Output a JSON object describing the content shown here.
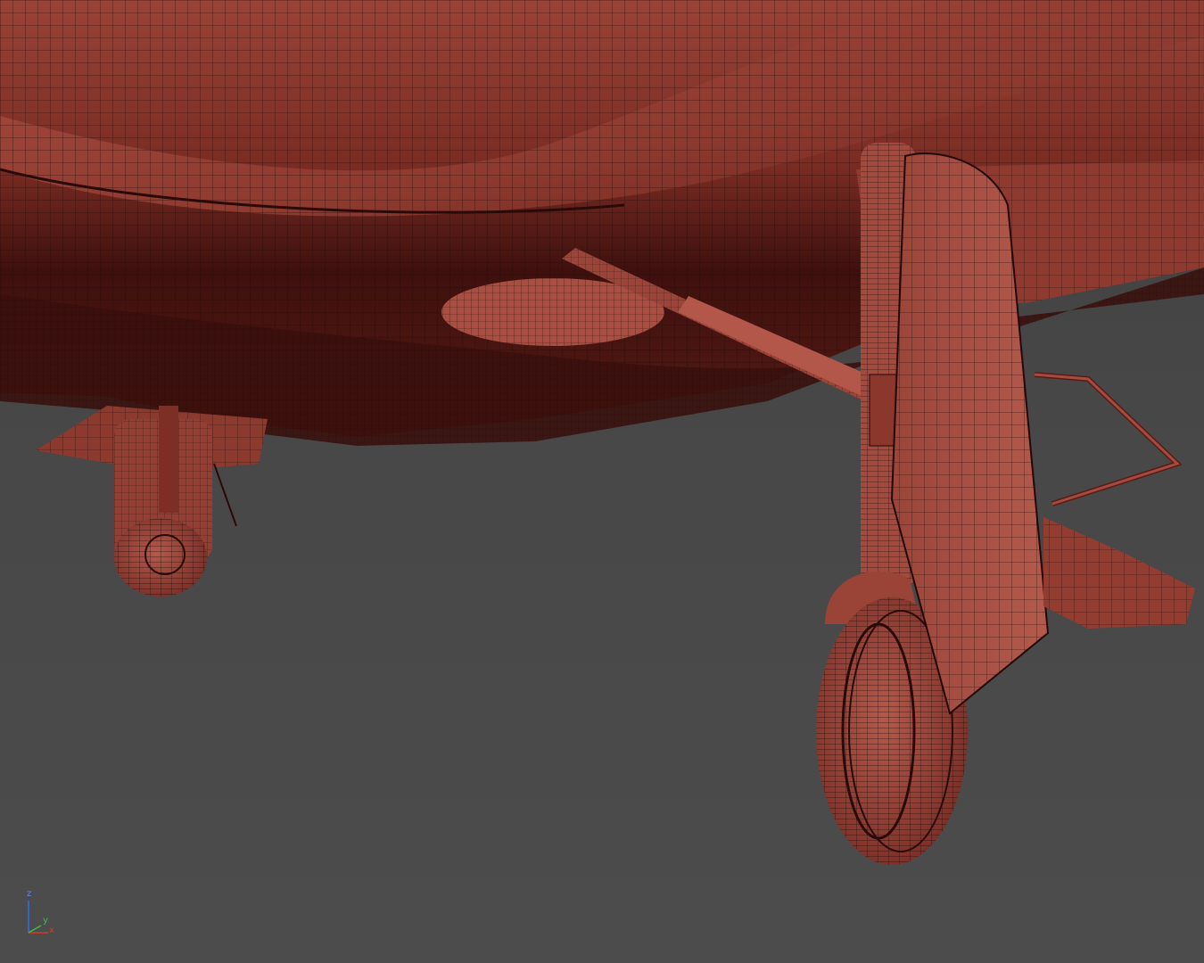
{
  "viewport": {
    "colors": {
      "background": "#4a4a4a",
      "mesh_face": "#a0463a",
      "mesh_shadow": "#3a0f0c",
      "wire": "#1e0706"
    },
    "gizmo": {
      "z_label": "z",
      "x_label": "x",
      "y_label": "y"
    }
  }
}
